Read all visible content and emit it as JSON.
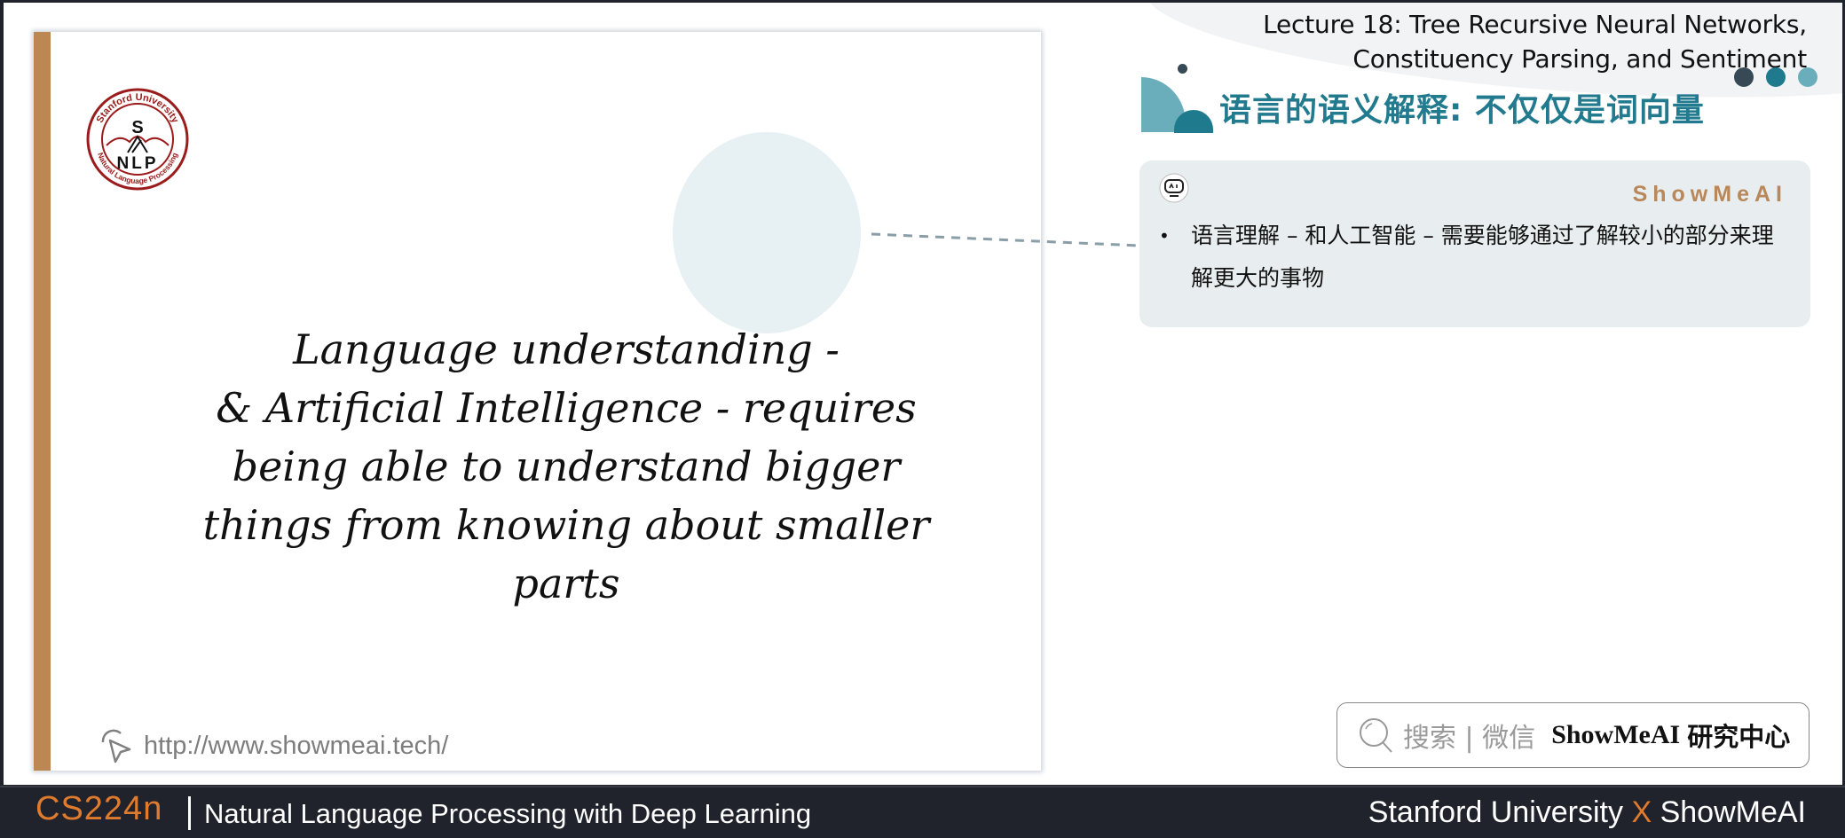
{
  "header": {
    "lecture_title_line1": "Lecture 18: Tree Recursive Neural Networks,",
    "lecture_title_line2": "Constituency Parsing, and Sentiment",
    "section_title": "语言的语义解释: 不仅仅是词向量",
    "dot_colors": [
      "#374955",
      "#1f7a8d",
      "#6aaebc"
    ]
  },
  "slide": {
    "logo": {
      "top_text": "Stanford University",
      "bottom_text": "Natural Language Processing",
      "center_letter": "S",
      "center_word": "NLP"
    },
    "quote_lines": [
      "Language understanding -",
      "& Artificial Intelligence - requires",
      "being able to understand bigger",
      "things from knowing about smaller",
      "parts"
    ],
    "link_text": "http://www.showmeai.tech/",
    "accent_color": "#bd8753"
  },
  "info_card": {
    "icon": "ai-robot-icon",
    "brand": "ShowMeAI",
    "bullets": [
      "语言理解 – 和人工智能 – 需要能够通过了解较小的部分来理解更大的事物"
    ]
  },
  "search_box": {
    "icon": "search-icon",
    "hint": "搜索 | 微信",
    "brand": "ShowMeAI",
    "suffix": "研究中心"
  },
  "footer": {
    "course_code": "CS224n",
    "course_name": "Natural Language Processing with Deep Learning",
    "right_left": "Stanford University",
    "right_x": "X",
    "right_right": "ShowMeAI"
  }
}
